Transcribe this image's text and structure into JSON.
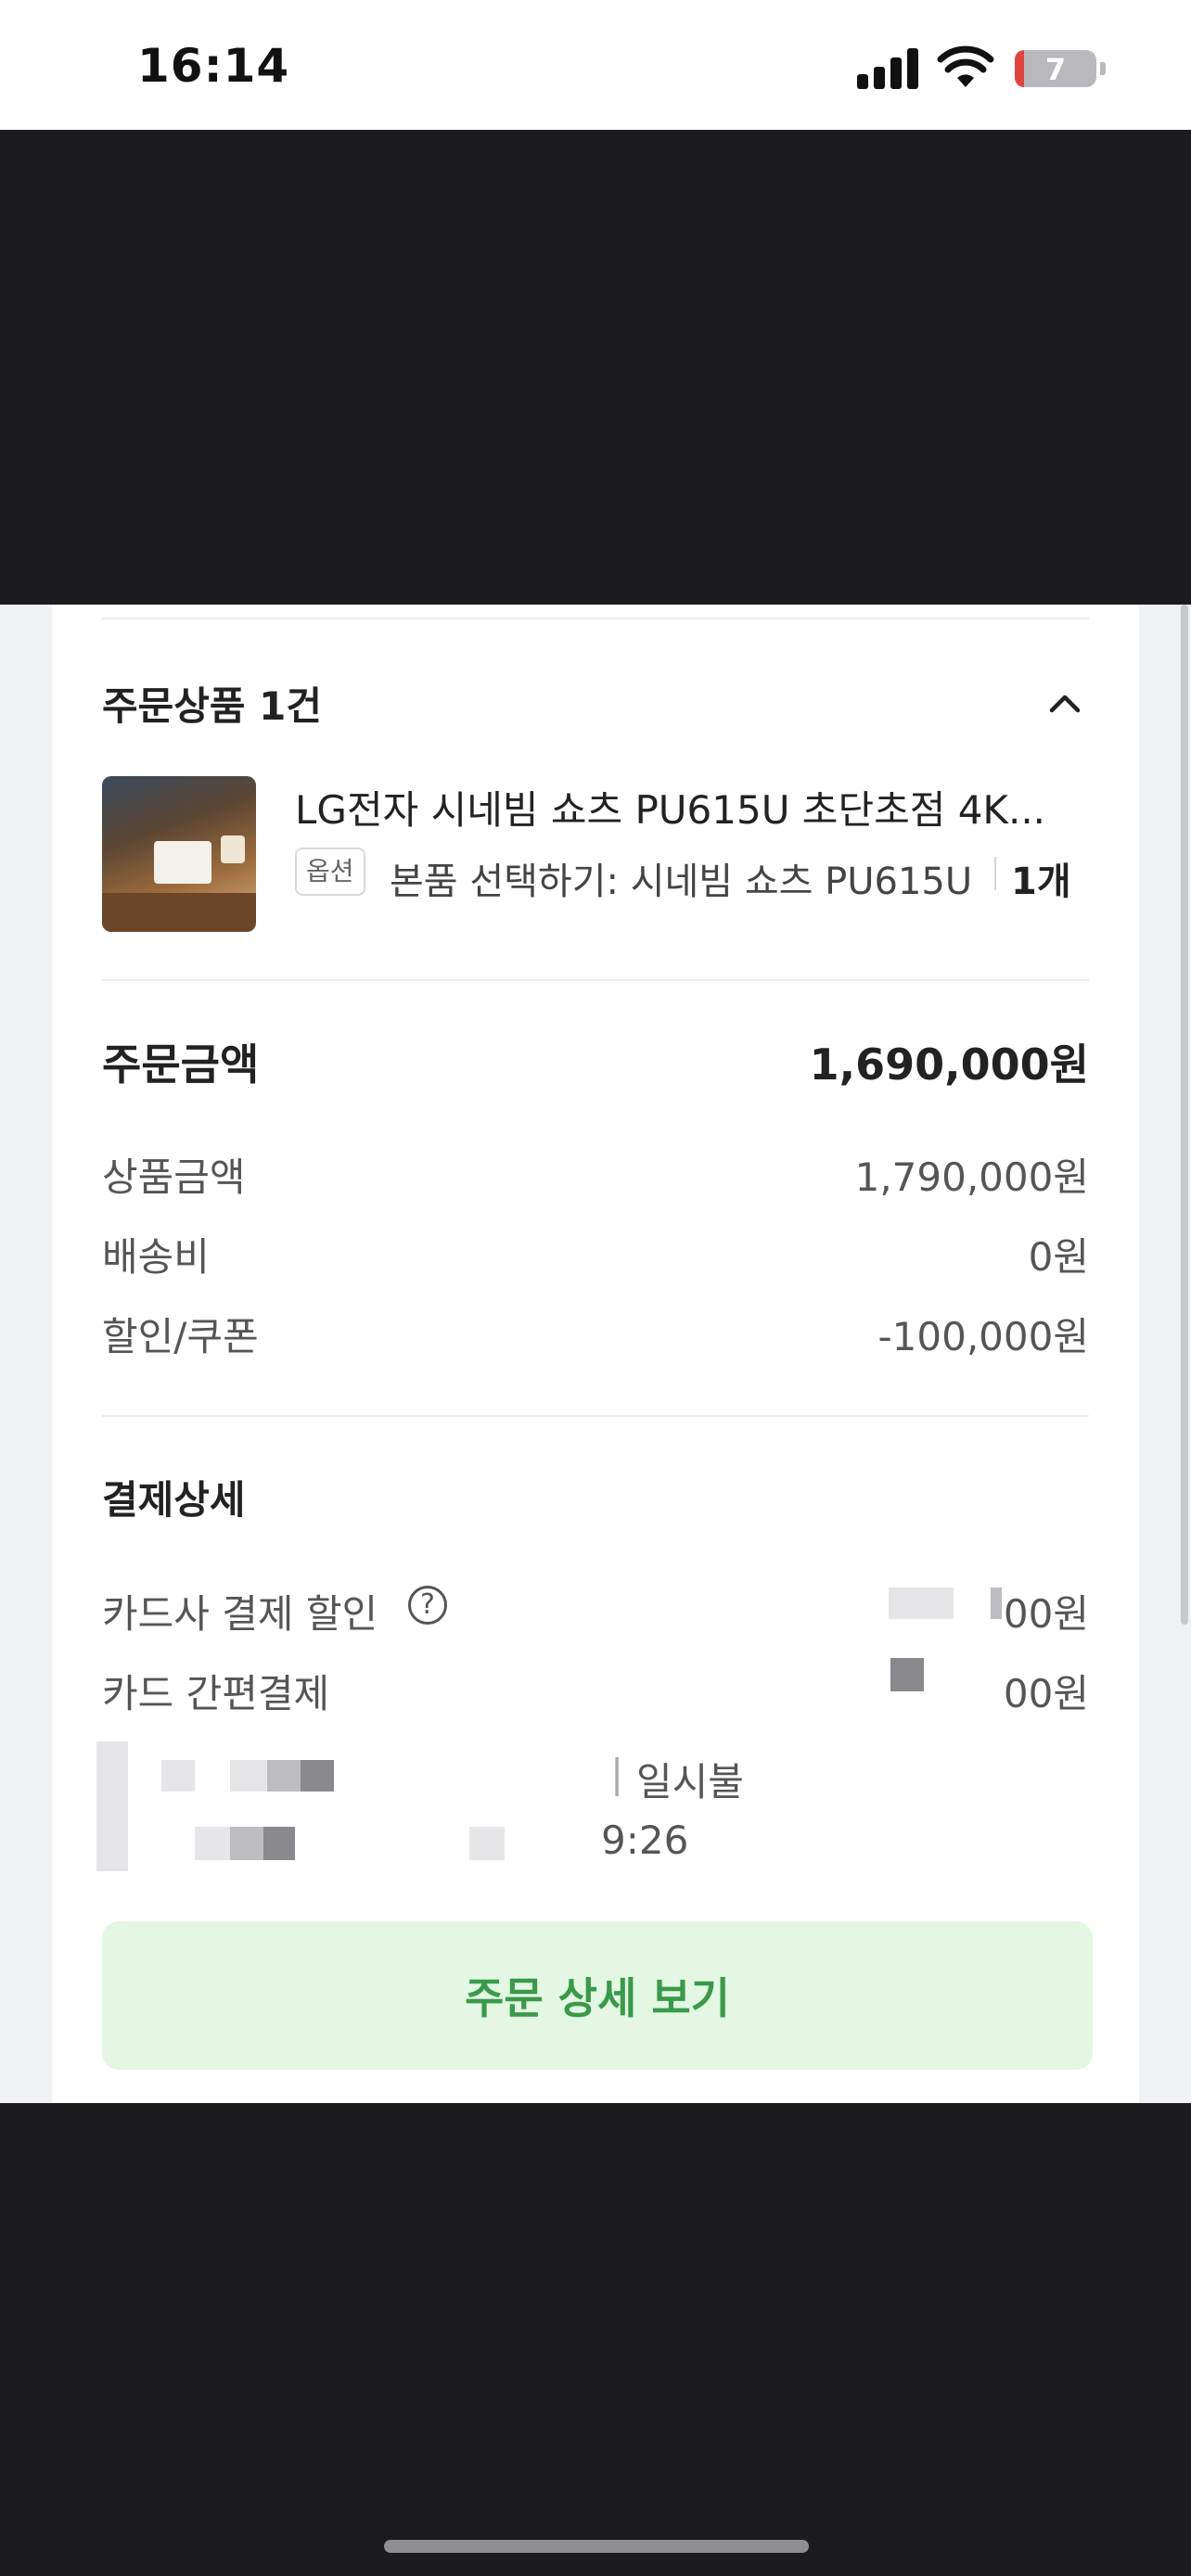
{
  "status_bar": {
    "time": "16:14",
    "battery_level": "7"
  },
  "order_items": {
    "title": "주문상품 1건",
    "product_name": "LG전자 시네빔 쇼츠 PU615U 초단초점 4K...",
    "option_badge": "옵션",
    "option_text": "본품 선택하기: 시네빔 쇼츠 PU615U",
    "quantity": "1개"
  },
  "order_amount": {
    "title": "주문금액",
    "total": "1,690,000원",
    "rows": [
      {
        "label": "상품금액",
        "value": "1,790,000원"
      },
      {
        "label": "배송비",
        "value": "0원"
      },
      {
        "label": "할인/쿠폰",
        "value": "-100,000원"
      }
    ]
  },
  "payment_detail": {
    "title": "결제상세",
    "card_discount_label": "카드사 결제 할인",
    "card_discount_help": "?",
    "card_discount_value_visible": "00원",
    "easy_pay_label": "카드 간편결제",
    "easy_pay_value_visible": "00원",
    "installment_visible": "일시불",
    "time_visible": "9:26"
  },
  "detail_button": {
    "label": "주문 상세 보기"
  },
  "colors": {
    "accent_green": "#3a9a4a",
    "button_bg": "#e3f7e3"
  }
}
